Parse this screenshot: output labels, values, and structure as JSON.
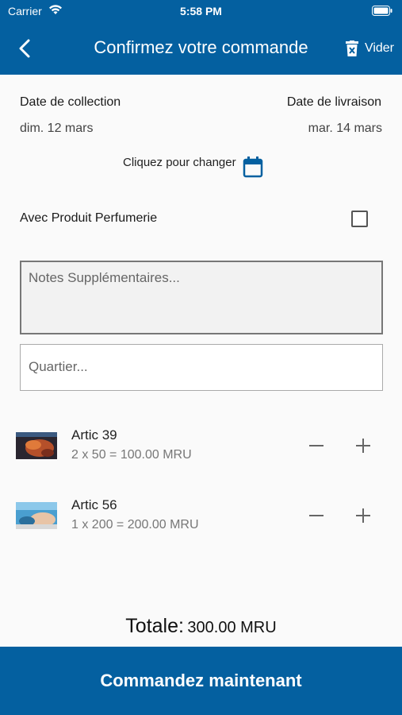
{
  "status_bar": {
    "carrier": "Carrier",
    "time": "5:58 PM"
  },
  "header": {
    "title": "Confirmez votre commande",
    "clear_label": "Vider"
  },
  "dates": {
    "collection_label": "Date de collection",
    "collection_value": "dim. 12 mars",
    "delivery_label": "Date de livraison",
    "delivery_value": "mar. 14 mars",
    "change_hint": "Cliquez pour changer"
  },
  "perfume": {
    "label": "Avec Produit Perfumerie",
    "checked": false
  },
  "inputs": {
    "notes_placeholder": "Notes Supplémentaires...",
    "district_placeholder": "Quartier..."
  },
  "cart": [
    {
      "name": "Artic 39",
      "calc": "2 x 50 = 100.00 MRU"
    },
    {
      "name": "Artic 56",
      "calc": "1 x 200 = 200.00 MRU"
    }
  ],
  "total": {
    "label": "Totale:",
    "value": "300.00 MRU"
  },
  "order_button": "Commandez maintenant",
  "colors": {
    "brand": "#0460a0",
    "background": "#fafafa"
  }
}
